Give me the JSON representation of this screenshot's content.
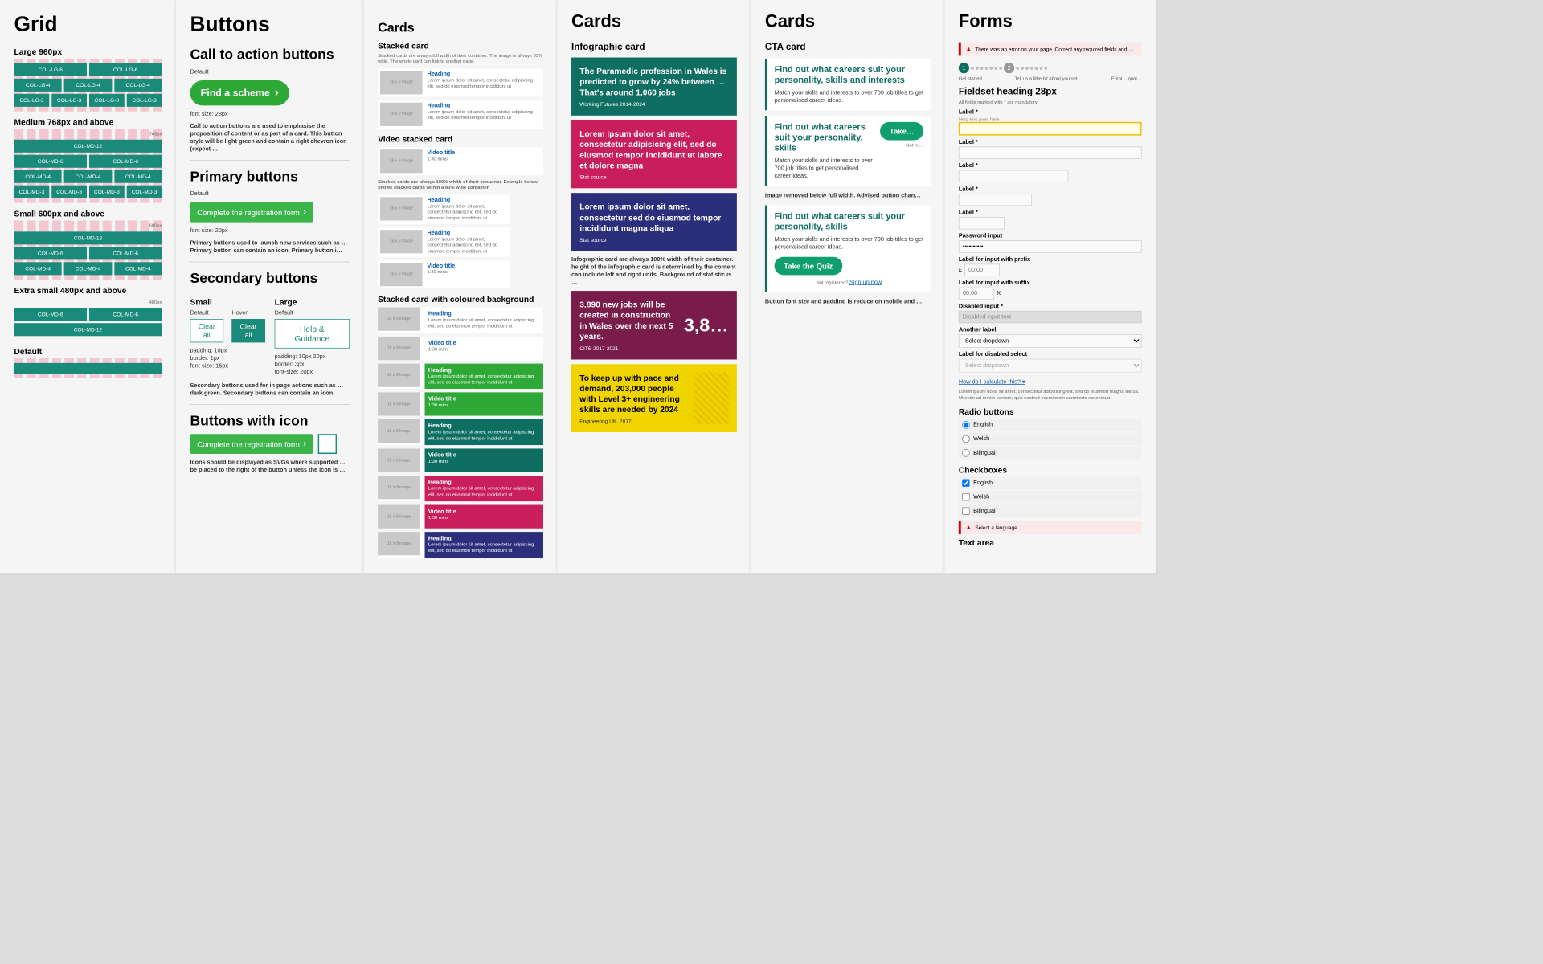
{
  "grid": {
    "title": "Grid",
    "large": "Large 960px",
    "medium": "Medium 768px and above",
    "small": "Small 600px and above",
    "xsmall": "Extra small 480px and above",
    "default": "Default",
    "mark768": "768px",
    "mark600": "600px",
    "mark480": "480px",
    "cols": {
      "lg6": "COL-LG-6",
      "lg4": "COL-LG-4",
      "lg3": "COL-LG-3",
      "md12": "COL-MD-12",
      "md6": "COL-MD-6",
      "md4": "COL-MD-4",
      "md3": "COL-MD-3"
    }
  },
  "buttons": {
    "title": "Buttons",
    "cta_h": "Call to action buttons",
    "default": "Default",
    "cta_label": "Find a scheme",
    "cta_size": "font size: 28px",
    "cta_desc": "Call to action buttons are used to emphasise the proposition of content or as part of a card. This button style will be light green and contain a right chevron icon (expect …",
    "pri_h": "Primary buttons",
    "pri_label": "Complete the registration form",
    "pri_size": "font size: 20px",
    "pri_desc": "Primary buttons used to launch new services such as … Primary button can contain an icon. Primary button i…",
    "sec_h": "Secondary buttons",
    "small": "Small",
    "large": "Large",
    "hover": "Hover",
    "clear": "Clear all",
    "help": "Help & Guidance",
    "spec_sm": "padding: 10px\nborder: 1px\nfont-size: 16px",
    "spec_lg": "padding: 10px 20px\nborder: 3px\nfont-size: 20px",
    "sec_desc": "Secondary buttons used for in page actions such as … dark green. Secondary buttons can contain an icon.",
    "icon_h": "Buttons with icon",
    "icon_desc": "Icons should be displayed as SVGs where supported … be placed to the right of the button unless the icon is …"
  },
  "cards1": {
    "title": "Cards",
    "sc_h": "Stacked card",
    "sc_note": "Stacked cards are always full width of their container. The image is always 33% wide. The whole card can link to another page.",
    "heading": "Heading",
    "video": "Video title",
    "dur": "1:30 mins",
    "thumb": "16 x 9 image",
    "lorem": "Lorem ipsum dolor sit amet, consectetur adipiscing elit, sed do eiusmod tempor incididunt ut",
    "sc80": "Stacked cards are always 100% width of their container. Example below shows stacked cards within a 80% wide container.",
    "bg_h": "Stacked card with coloured background"
  },
  "cards2": {
    "title": "Cards",
    "info_h": "Infographic card",
    "c1_t": "The Paramedic profession in Wales is predicted to grow by 24% between … That's around 1,060 jobs",
    "c1_s": "Working Futures 2014-2024",
    "c2_t": "Lorem ipsum dolor sit amet, consectetur adipisicing elit, sed do eiusmod tempor incididunt ut labore et dolore magna",
    "c2_s": "Stat source",
    "c3_t": "Lorem ipsum dolor sit amet, consectetur sed do eiusmod tempor incididunt magna aliqua",
    "c3_s": "Stat source",
    "note": "Infographic card are always 100% width of their container. height of the infographic card is determined by the content can include left and right units. Background of statistic is …",
    "c4_t": "3,890 new jobs will be created in construction in Wales over the next 5 years.",
    "c4_big": "3,8…",
    "c4_s": "CITB 2017-2021",
    "c5_t": "To keep up with pace and demand, 203,000 people with Level 3+ engineering skills are needed by 2024",
    "c5_s": "Engineering UK, 2017"
  },
  "cards3": {
    "title": "Cards",
    "h": "CTA card",
    "t1": "Find out what careers suit your personality, skills and interests",
    "sub": "Match your skills and interests to over 700 job titles to get personalised career ideas.",
    "t2": "Find out what careers suit your personality, skills",
    "take": "Take…",
    "notreg": "Not re…",
    "imgnote": "Image removed below full width. Advised button chan…",
    "quiz": "Take the Quiz",
    "signup": "Not registered? ",
    "signup_link": "Sign up now",
    "reduce": "Button font size and padding is reduce on mobile and …"
  },
  "forms": {
    "title": "Forms",
    "err": "There was an error on your page. Correct any required fields and …",
    "step1": "Get started",
    "step2": "Tell us a little bit about yourself",
    "step3": "Empl… qual…",
    "fs_h": "Fieldset heading 28px",
    "mand": "All fields marked with * are mandatory",
    "label": "Label *",
    "help": "Help text goes here",
    "pwd_l": "Password input",
    "pwd_v": "••••••••••",
    "pfx_l": "Label for input with prefix",
    "pfx": "£",
    "pfx_ph": "00.00",
    "sfx_l": "Label for input with suffix",
    "sfx": "%",
    "sfx_ph": "00.00",
    "dis_l": "Disabled input *",
    "dis_v": "Disabled input text",
    "another": "Another label",
    "sel": "Select dropdown",
    "dissel_l": "Label for disabled select",
    "calc": "How do I calculate this? ",
    "calc_t": "Lorem ipsum dolor sit amet, consectetur adipisicing elit, sed do eiusmod magna aliqua. Ut enim ad minim veniam, quis nostrud exercitation commodo consequat.",
    "radio_h": "Radio buttons",
    "check_h": "Checkboxes",
    "en": "English",
    "we": "Welsh",
    "bi": "Bilingual",
    "sel_err": "Select a language",
    "ta": "Text area"
  }
}
